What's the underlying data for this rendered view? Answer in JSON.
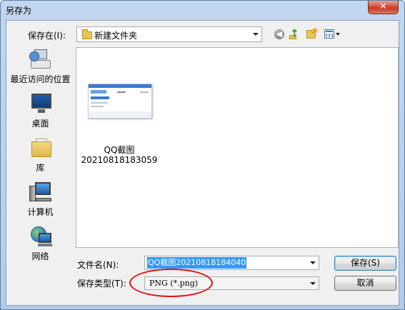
{
  "window": {
    "title": "另存为",
    "close_glyph": "✕"
  },
  "toolbar": {
    "save_in_label": "保存在(I):",
    "current_folder": "新建文件夹",
    "back_glyph": "◀",
    "up_glyph": "↑"
  },
  "places": [
    {
      "label": "最近访问的位置",
      "icon": "recent-places-icon"
    },
    {
      "label": "桌面",
      "icon": "desktop-icon"
    },
    {
      "label": "库",
      "icon": "libraries-icon"
    },
    {
      "label": "计算机",
      "icon": "computer-icon"
    },
    {
      "label": "网络",
      "icon": "network-icon"
    }
  ],
  "files": [
    {
      "name_line1": "QQ截图",
      "name_line2": "20210818183059",
      "icon": "image-thumbnail"
    }
  ],
  "form": {
    "filename_label": "文件名(N):",
    "filename_value": "QQ截图20210818184040",
    "filetype_label": "保存类型(T):",
    "filetype_value": "PNG (*.png)"
  },
  "buttons": {
    "save": "保存(S)",
    "cancel": "取消"
  },
  "colors": {
    "title_gradient": "#c2d7ef",
    "close_button": "#c23b22",
    "selection": "#3399ff",
    "annotation_ellipse": "#e01010"
  }
}
